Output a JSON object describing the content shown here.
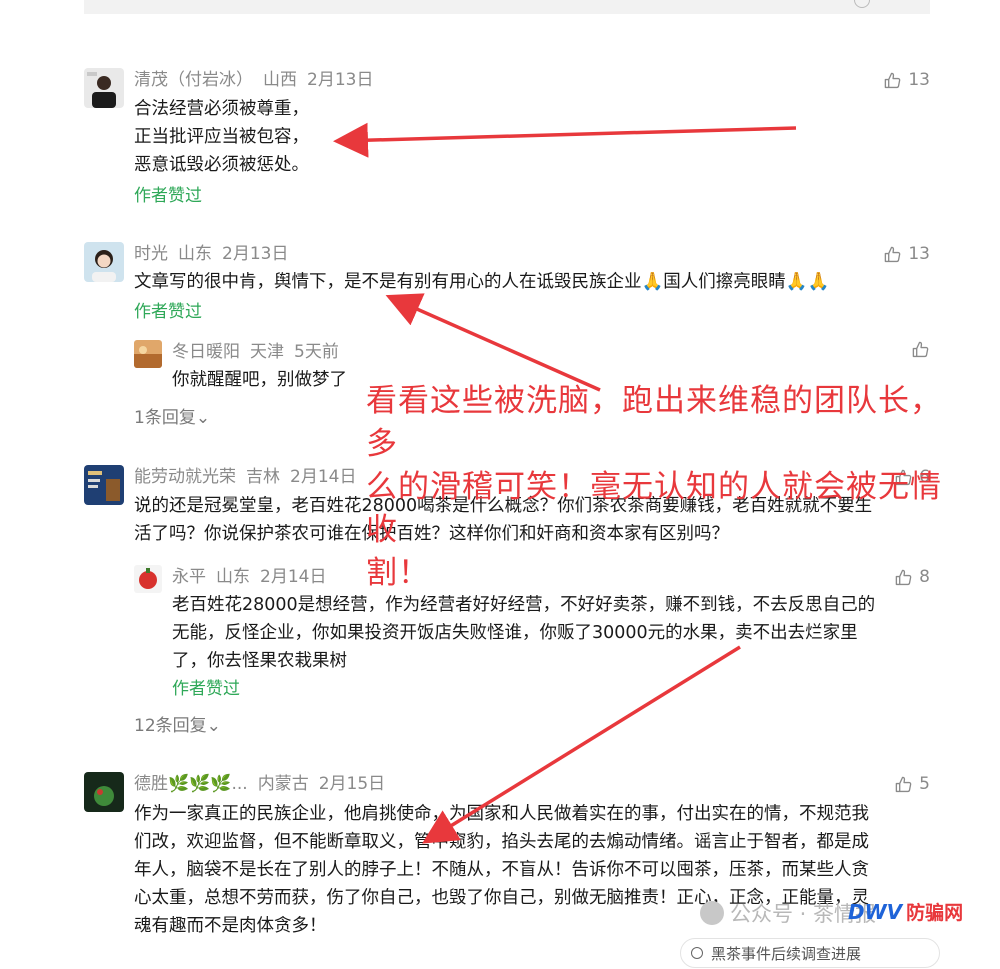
{
  "comments": [
    {
      "name": "清茂（付岩冰）",
      "location": "山西",
      "date": "2月13日",
      "likes": "13",
      "lines": [
        "合法经营必须被尊重，",
        "正当批评应当被包容，",
        "恶意诋毁必须被惩处。"
      ],
      "author_liked": "作者赞过"
    },
    {
      "name": "时光",
      "location": "山东",
      "date": "2月13日",
      "likes": "13",
      "lines": [
        "文章写的很中肯，舆情下，是不是有别有用心的人在诋毁民族企业🙏国人们擦亮眼睛🙏🙏"
      ],
      "author_liked": "作者赞过",
      "reply": {
        "name": "冬日暖阳",
        "location": "天津",
        "date": "5天前",
        "text": "你就醒醒吧，别做梦了"
      },
      "replies_label": "1条回复⌄"
    },
    {
      "name": "能劳动就光荣",
      "location": "吉林",
      "date": "2月14日",
      "likes": "6",
      "lines": [
        "说的还是冠冕堂皇，老百姓花28000喝茶是什么概念？你们茶农茶商要赚钱，老百姓就就不要生",
        "活了吗？你说保护茶农可谁在保护百姓？这样你们和奸商和资本家有区别吗？"
      ],
      "reply": {
        "name": "永平",
        "location": "山东",
        "date": "2月14日",
        "likes": "8",
        "lines": [
          "老百姓花28000是想经营，作为经营者好好经营，不好好卖茶，赚不到钱，不去反思自己的",
          "无能，反怪企业，你如果投资开饭店失败怪谁，你贩了30000元的水果，卖不出去烂家里",
          "了，你去怪果农栽果树"
        ],
        "author_liked": "作者赞过"
      },
      "replies_label": "12条回复⌄"
    },
    {
      "name": "德胜🌿🌿🌿...",
      "location": "内蒙古",
      "date": "2月15日",
      "likes": "5",
      "lines": [
        "作为一家真正的民族企业，他肩挑使命，为国家和人民做着实在的事，付出实在的情，不规范我",
        "们改，欢迎监督，但不能断章取义，管中窥豹，掐头去尾的去煽动情绪。谣言止于智者，都是成",
        "年人，脑袋不是长在了别人的脖子上！不随从，不盲从！告诉你不可以囤茶，压茶，而某些人贪",
        "心太重，总想不劳而获，伤了你自己，也毁了你自己，别做无脑推责！正心，正念，正能量，灵",
        "魂有趣而不是肉体贪多！"
      ]
    }
  ],
  "overlay": {
    "lines": [
      "看看这些被洗脑，跑出来维稳的团队长，多",
      "么的滑稽可笑！毫无认知的人就会被无情收",
      "割！"
    ]
  },
  "watermark": {
    "text": "公众号 · 茶情报",
    "brand_logo": "DWV",
    "brand_text": "防骗网"
  },
  "bottom_bar": {
    "text": "黑茶事件后续调查进展"
  },
  "colors": {
    "accent_green": "#2fa858",
    "annotation_red": "#e8383c",
    "meta_gray": "#8a8a8a"
  }
}
